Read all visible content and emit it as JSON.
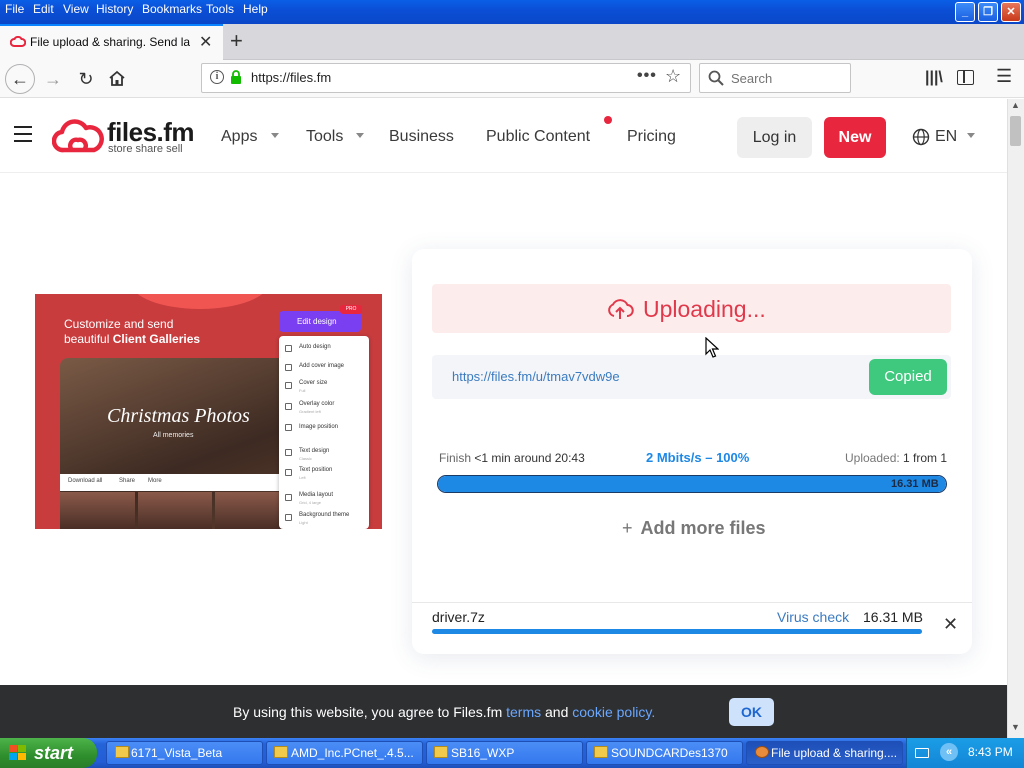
{
  "window": {
    "menu": [
      "File",
      "Edit",
      "View",
      "History",
      "Bookmarks",
      "Tools",
      "Help"
    ],
    "controls": [
      "_",
      "❐",
      "✕"
    ]
  },
  "browser": {
    "tab_title": "File upload & sharing. Send large p",
    "new_tab": "+",
    "url": "https://files.fm",
    "url_more": "•••",
    "search_placeholder": "Search"
  },
  "site": {
    "logo_name": "files.fm",
    "logo_tagline": "store share sell",
    "nav": {
      "apps": "Apps",
      "tools": "Tools",
      "business": "Business",
      "public_content": "Public Content",
      "pricing": "Pricing"
    },
    "login": "Log in",
    "new": "New",
    "language": "EN"
  },
  "promo": {
    "line1": "Customize and send",
    "line2_plain": "beautiful ",
    "line2_bold": "Client Galleries",
    "photo_title": "Christmas Photos",
    "photo_subtitle": "All memories",
    "bar_items": [
      "Download all",
      "Share",
      "More"
    ],
    "edit_button": "Edit design",
    "pro_badge": "PRO",
    "menu": [
      {
        "label": "Auto design",
        "sub": ""
      },
      {
        "label": "Add cover image",
        "sub": ""
      },
      {
        "label": "Cover size",
        "sub": "Full"
      },
      {
        "label": "Overlay color",
        "sub": "Gradient left"
      },
      {
        "label": "Image position",
        "sub": ""
      },
      {
        "label": "Text design",
        "sub": "Classic"
      },
      {
        "label": "Text position",
        "sub": "Left"
      },
      {
        "label": "Media layout",
        "sub": "Grid, 4 large"
      },
      {
        "label": "Background theme",
        "sub": "Light"
      }
    ]
  },
  "upload": {
    "status": "Uploading...",
    "link": "https://files.fm/u/tmav7vdw9e",
    "copied": "Copied",
    "finish_label": "Finish ",
    "finish_value": "<1 min around 20:43",
    "speed": "2 Mbits/s – 100%",
    "uploaded_label": "Uploaded: ",
    "uploaded_value": "1 from 1",
    "progress_percent": 100,
    "total_size": "16.31 MB",
    "add_more_plus": "+",
    "add_more": "Add more files",
    "file": {
      "name": "driver.7z",
      "virus_check": "Virus check",
      "size": "16.31 MB",
      "progress_percent": 100,
      "remove": "✕"
    }
  },
  "cookie": {
    "text_before": "By using this website, you agree to Files.fm ",
    "terms": "terms",
    "and": " and ",
    "policy": "cookie policy.",
    "ok": "OK"
  },
  "taskbar": {
    "start": "start",
    "tasks": [
      "6171_Vista_Beta",
      "AMD_Inc.PCnet_.4.5...",
      "SB16_WXP",
      "SOUNDCARDes1370",
      "File upload & sharing...."
    ],
    "tray_arrow": "«",
    "clock": "8:43 PM"
  },
  "colors": {
    "brand_red": "#e8263e",
    "link_blue": "#3b7bc0",
    "progress_blue": "#1e88e5",
    "copied_green": "#3ec97e"
  }
}
